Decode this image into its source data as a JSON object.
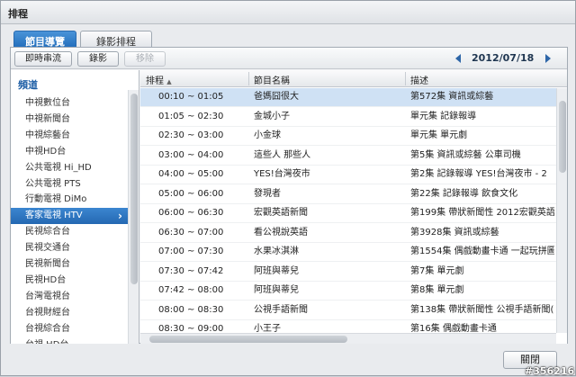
{
  "window": {
    "title": "排程"
  },
  "tabs": [
    {
      "label": "節目導覽",
      "active": true
    },
    {
      "label": "錄影排程",
      "active": false
    }
  ],
  "toolbar": {
    "stream_label": "即時串流",
    "record_label": "錄影",
    "remove_label": "移除",
    "date": "2012/07/18"
  },
  "sidebar": {
    "header": "頻道",
    "selected_index": 7,
    "items": [
      "中視數位台",
      "中視新聞台",
      "中視綜藝台",
      "中視HD台",
      "公共電視 Hi_HD",
      "公共電視 PTS",
      "行動電視 DiMo",
      "客家電視 HTV",
      "民視綜合台",
      "民視交通台",
      "民視新聞台",
      "民視HD台",
      "台灣電視台",
      "台視財經台",
      "台視綜合台",
      "台視 HD台"
    ]
  },
  "grid": {
    "columns": [
      "排程",
      "節目名稱",
      "描述"
    ],
    "sort_indicator": "▲",
    "rows": [
      {
        "time": "00:10 ~ 01:05",
        "name": "爸媽囧很大",
        "desc": "第572集 資訊或綜藝",
        "selected": true
      },
      {
        "time": "01:05 ~ 02:30",
        "name": "金城小子",
        "desc": "單元集 記錄報導"
      },
      {
        "time": "02:30 ~ 03:00",
        "name": "小金球",
        "desc": "單元集 單元劇"
      },
      {
        "time": "03:00 ~ 04:00",
        "name": "這些人 那些人",
        "desc": "第5集 資訊或綜藝 公車司機"
      },
      {
        "time": "04:00 ~ 05:00",
        "name": "YES!台灣夜市",
        "desc": "第2集 記錄報導 YES!台灣夜市 - 2"
      },
      {
        "time": "05:00 ~ 06:00",
        "name": "發現者",
        "desc": "第22集 記錄報導 飲食文化"
      },
      {
        "time": "06:00 ~ 06:30",
        "name": "宏觀英語新聞",
        "desc": "第199集 帶狀新聞性 2012宏觀英語新"
      },
      {
        "time": "06:30 ~ 07:00",
        "name": "看公視說英語",
        "desc": "第3928集 資訊或綜藝"
      },
      {
        "time": "07:00 ~ 07:30",
        "name": "水果冰淇淋",
        "desc": "第1554集 偶戲動畫卡通 一起玩拼圖"
      },
      {
        "time": "07:30 ~ 07:42",
        "name": "阿班與蒂兒",
        "desc": "第7集 單元劇"
      },
      {
        "time": "07:42 ~ 08:00",
        "name": "阿班與蒂兒",
        "desc": "第8集 單元劇"
      },
      {
        "time": "08:00 ~ 08:30",
        "name": "公視手語新聞",
        "desc": "第138集 帶狀新聞性 公視手語新聞(2"
      },
      {
        "time": "08:30 ~ 09:00",
        "name": "小王子",
        "desc": "第16集 偶戲動畫卡通"
      }
    ]
  },
  "footer": {
    "close_label": "關閉"
  },
  "watermark": "#356216"
}
